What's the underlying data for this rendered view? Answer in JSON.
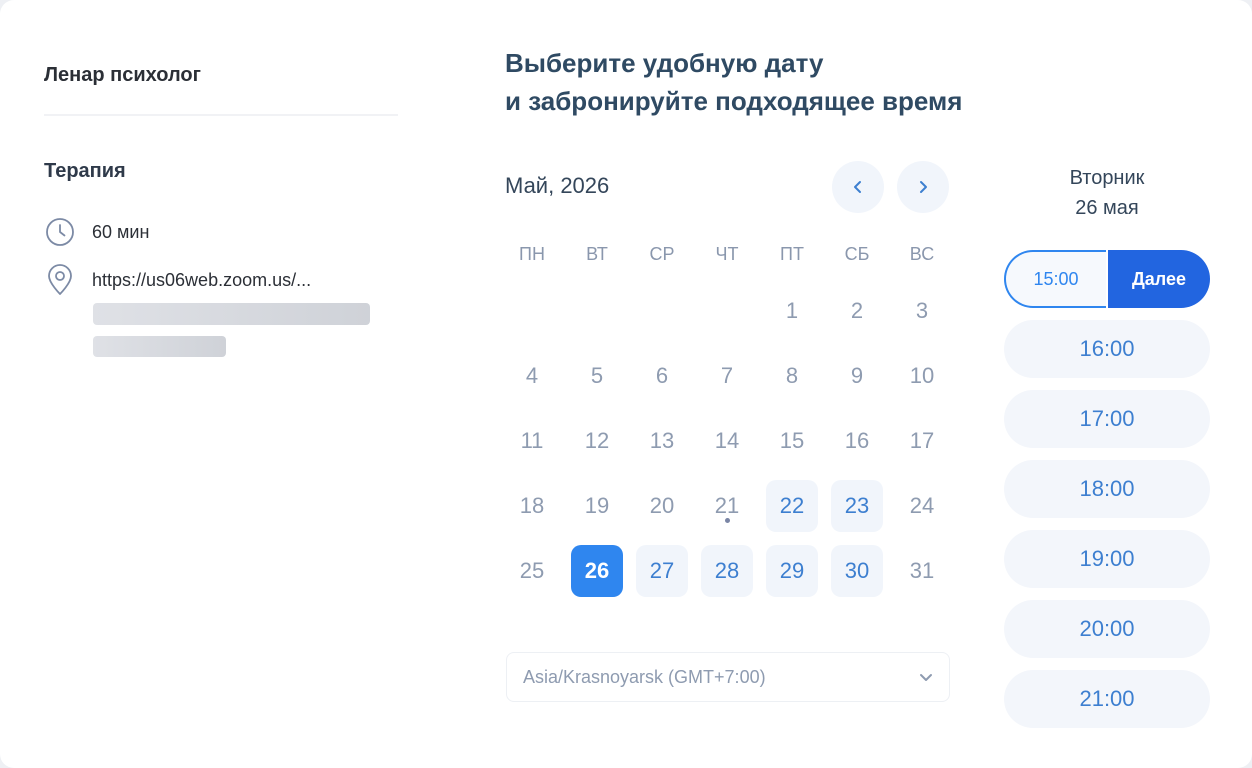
{
  "host": {
    "name": "Ленар психолог"
  },
  "event": {
    "title": "Терапия",
    "duration": "60 мин",
    "location": "https://us06web.zoom.us/...",
    "duration_icon": "clock-icon",
    "location_icon": "map-pin-icon"
  },
  "heading": {
    "line1": "Выберите удобную дату",
    "line2": "и забронируйте подходящее время"
  },
  "calendar": {
    "month_label": "Май, 2026",
    "weekdays": [
      "ПН",
      "ВТ",
      "СР",
      "ЧТ",
      "ПТ",
      "СБ",
      "ВС"
    ],
    "weeks": [
      [
        "",
        "",
        "",
        "",
        "1",
        "2",
        "3"
      ],
      [
        "4",
        "5",
        "6",
        "7",
        "8",
        "9",
        "10"
      ],
      [
        "11",
        "12",
        "13",
        "14",
        "15",
        "16",
        "17"
      ],
      [
        "18",
        "19",
        "20",
        "21",
        "22",
        "23",
        "24"
      ],
      [
        "25",
        "26",
        "27",
        "28",
        "29",
        "30",
        "31"
      ]
    ],
    "available_days": [
      "22",
      "23",
      "27",
      "28",
      "29",
      "30"
    ],
    "selected_day": "26",
    "today_marker_day": "21",
    "timezone": "Asia/Krasnoyarsk (GMT+7:00)"
  },
  "times": {
    "weekday": "Вторник",
    "date": "26 мая",
    "selected_time": "15:00",
    "next_label": "Далее",
    "slots": [
      "16:00",
      "17:00",
      "18:00",
      "19:00",
      "20:00",
      "21:00"
    ]
  },
  "colors": {
    "accent": "#2f86ef",
    "next_button": "#2265e0",
    "available_bg": "#f1f5fb",
    "muted_text": "#8e9bb0"
  }
}
